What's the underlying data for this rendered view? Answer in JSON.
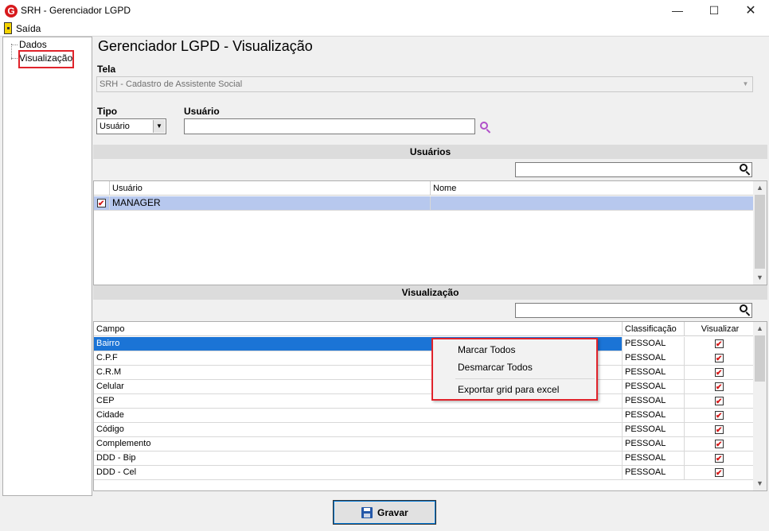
{
  "window": {
    "title": "SRH - Gerenciador LGPD",
    "minimize": "—",
    "maximize": "☐",
    "close": "✕"
  },
  "menu": {
    "exit_label": "Saída"
  },
  "tree": {
    "items": [
      "Dados",
      "Visualização"
    ],
    "selected": "Visualização"
  },
  "page": {
    "title": "Gerenciador LGPD - Visualização"
  },
  "form": {
    "tela_label": "Tela",
    "tela_value": "SRH - Cadastro de Assistente Social",
    "tipo_label": "Tipo",
    "tipo_value": "Usuário",
    "usuario_label": "Usuário",
    "usuario_value": ""
  },
  "users_section": {
    "header": "Usuários",
    "columns": [
      "Usuário",
      "Nome"
    ],
    "rows": [
      {
        "checked": true,
        "usuario": "MANAGER",
        "nome": ""
      }
    ]
  },
  "vis_section": {
    "header": "Visualização",
    "columns": [
      "Campo",
      "Classificação",
      "Visualizar"
    ],
    "rows": [
      {
        "campo": "Bairro",
        "classificacao": "PESSOAL",
        "visualizar": true
      },
      {
        "campo": "C.P.F",
        "classificacao": "PESSOAL",
        "visualizar": true
      },
      {
        "campo": "C.R.M",
        "classificacao": "PESSOAL",
        "visualizar": true
      },
      {
        "campo": "Celular",
        "classificacao": "PESSOAL",
        "visualizar": true
      },
      {
        "campo": "CEP",
        "classificacao": "PESSOAL",
        "visualizar": true
      },
      {
        "campo": "Cidade",
        "classificacao": "PESSOAL",
        "visualizar": true
      },
      {
        "campo": "Código",
        "classificacao": "PESSOAL",
        "visualizar": true
      },
      {
        "campo": "Complemento",
        "classificacao": "PESSOAL",
        "visualizar": true
      },
      {
        "campo": "DDD - Bip",
        "classificacao": "PESSOAL",
        "visualizar": true
      },
      {
        "campo": "DDD - Cel",
        "classificacao": "PESSOAL",
        "visualizar": true
      }
    ]
  },
  "context_menu": {
    "items": [
      "Marcar Todos",
      "Desmarcar Todos",
      "Exportar grid para excel"
    ]
  },
  "footer": {
    "save_label": "Gravar"
  },
  "colors": {
    "highlight_red": "#e0232b",
    "row_selected": "#1b74d6",
    "user_row_selected": "#b7c8ee",
    "check_red": "#d51a1a",
    "search_purple": "#b04fc9"
  }
}
